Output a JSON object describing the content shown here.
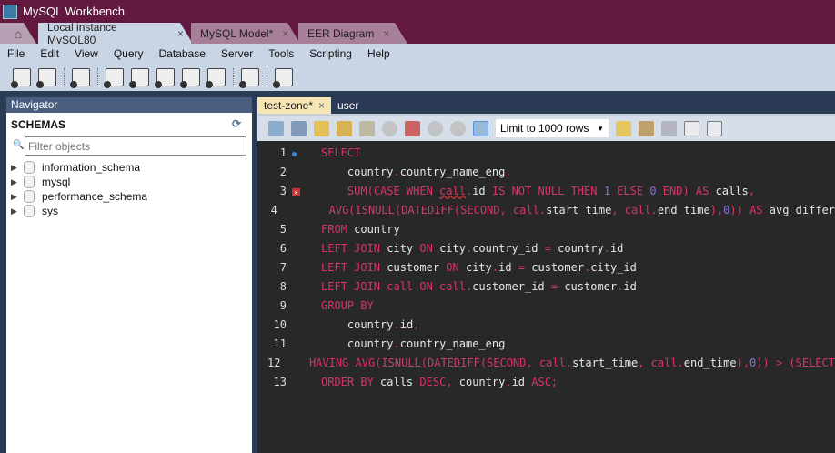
{
  "window": {
    "title": "MySQL Workbench"
  },
  "doc_tabs": [
    {
      "label": "Local instance MySQL80",
      "active": true
    },
    {
      "label": "MySQL Model*"
    },
    {
      "label": "EER Diagram"
    }
  ],
  "menu": [
    "File",
    "Edit",
    "View",
    "Query",
    "Database",
    "Server",
    "Tools",
    "Scripting",
    "Help"
  ],
  "navigator": {
    "title": "Navigator",
    "section": "SCHEMAS",
    "filter_placeholder": "Filter objects",
    "schemas": [
      "information_schema",
      "mysql",
      "performance_schema",
      "sys"
    ]
  },
  "query_tabs": [
    {
      "label": "test-zone*",
      "active": true
    },
    {
      "label": "user"
    }
  ],
  "query_toolbar": {
    "limit": "Limit to 1000 rows"
  },
  "colors": {
    "keyword": "#d93366",
    "function": "#c2416f",
    "identifier": "#e6e6e6",
    "number": "#8c6fe0",
    "editor_bg": "#282828",
    "title_bg": "#63193f"
  },
  "code": [
    {
      "n": "1",
      "marker": "dot",
      "tokens": [
        [
          "SELECT",
          "k"
        ]
      ]
    },
    {
      "n": "2",
      "tokens": [
        [
          "    country",
          "i"
        ],
        [
          ".",
          "p"
        ],
        [
          "country_name_eng",
          "i"
        ],
        [
          ",",
          "p"
        ]
      ]
    },
    {
      "n": "3",
      "marker": "error",
      "tokens": [
        [
          "    SUM",
          "f"
        ],
        [
          "(",
          "p"
        ],
        [
          "CASE WHEN ",
          "k"
        ],
        [
          "call",
          "u"
        ],
        [
          ".",
          "p"
        ],
        [
          "id ",
          "i"
        ],
        [
          "IS NOT NULL THEN ",
          "k"
        ],
        [
          "1",
          "n"
        ],
        [
          " ELSE ",
          "k"
        ],
        [
          "0",
          "n"
        ],
        [
          " END) AS ",
          "k"
        ],
        [
          "calls",
          "i"
        ],
        [
          ",",
          "p"
        ]
      ]
    },
    {
      "n": "4",
      "tokens": [
        [
          "    AVG",
          "f"
        ],
        [
          "(",
          "p"
        ],
        [
          "ISNULL",
          "f"
        ],
        [
          "(",
          "p"
        ],
        [
          "DATEDIFF",
          "f"
        ],
        [
          "(SECOND, call.",
          "k"
        ],
        [
          "start_time",
          "i"
        ],
        [
          ", call.",
          "k"
        ],
        [
          "end_time",
          "i"
        ],
        [
          "),",
          "p"
        ],
        [
          "0",
          "n"
        ],
        [
          ")) AS ",
          "k"
        ],
        [
          "avg_differ",
          "i"
        ]
      ]
    },
    {
      "n": "5",
      "tokens": [
        [
          "FROM ",
          "k"
        ],
        [
          "country",
          "i"
        ]
      ]
    },
    {
      "n": "6",
      "tokens": [
        [
          "LEFT JOIN ",
          "k"
        ],
        [
          "city ",
          "i"
        ],
        [
          "ON ",
          "k"
        ],
        [
          "city",
          "i"
        ],
        [
          ".",
          "p"
        ],
        [
          "country_id ",
          "i"
        ],
        [
          "= ",
          "p"
        ],
        [
          "country",
          "i"
        ],
        [
          ".",
          "p"
        ],
        [
          "id",
          "i"
        ]
      ]
    },
    {
      "n": "7",
      "tokens": [
        [
          "LEFT JOIN ",
          "k"
        ],
        [
          "customer ",
          "i"
        ],
        [
          "ON ",
          "k"
        ],
        [
          "city",
          "i"
        ],
        [
          ".",
          "p"
        ],
        [
          "id ",
          "i"
        ],
        [
          "= ",
          "p"
        ],
        [
          "customer",
          "i"
        ],
        [
          ".",
          "p"
        ],
        [
          "city_id",
          "i"
        ]
      ]
    },
    {
      "n": "8",
      "tokens": [
        [
          "LEFT JOIN call ON call.",
          "k"
        ],
        [
          "customer_id ",
          "i"
        ],
        [
          "= ",
          "p"
        ],
        [
          "customer",
          "i"
        ],
        [
          ".",
          "p"
        ],
        [
          "id",
          "i"
        ]
      ]
    },
    {
      "n": "9",
      "tokens": [
        [
          "GROUP BY",
          "k"
        ]
      ]
    },
    {
      "n": "10",
      "tokens": [
        [
          "    country",
          "i"
        ],
        [
          ".",
          "p"
        ],
        [
          "id",
          "i"
        ],
        [
          ",",
          "p"
        ]
      ]
    },
    {
      "n": "11",
      "tokens": [
        [
          "    country",
          "i"
        ],
        [
          ".",
          "p"
        ],
        [
          "country_name_eng",
          "i"
        ]
      ]
    },
    {
      "n": "12",
      "tokens": [
        [
          "HAVING AVG",
          "k"
        ],
        [
          "(",
          "p"
        ],
        [
          "ISNULL",
          "f"
        ],
        [
          "(",
          "p"
        ],
        [
          "DATEDIFF",
          "f"
        ],
        [
          "(SECOND, call.",
          "k"
        ],
        [
          "start_time",
          "i"
        ],
        [
          ", call.",
          "k"
        ],
        [
          "end_time",
          "i"
        ],
        [
          "),",
          "p"
        ],
        [
          "0",
          "n"
        ],
        [
          ")) > (SELECT",
          "k"
        ]
      ]
    },
    {
      "n": "13",
      "tokens": [
        [
          "ORDER BY ",
          "k"
        ],
        [
          "calls ",
          "i"
        ],
        [
          "DESC, ",
          "k"
        ],
        [
          "country",
          "i"
        ],
        [
          ".",
          "p"
        ],
        [
          "id ",
          "i"
        ],
        [
          "ASC;",
          "k"
        ]
      ]
    }
  ]
}
